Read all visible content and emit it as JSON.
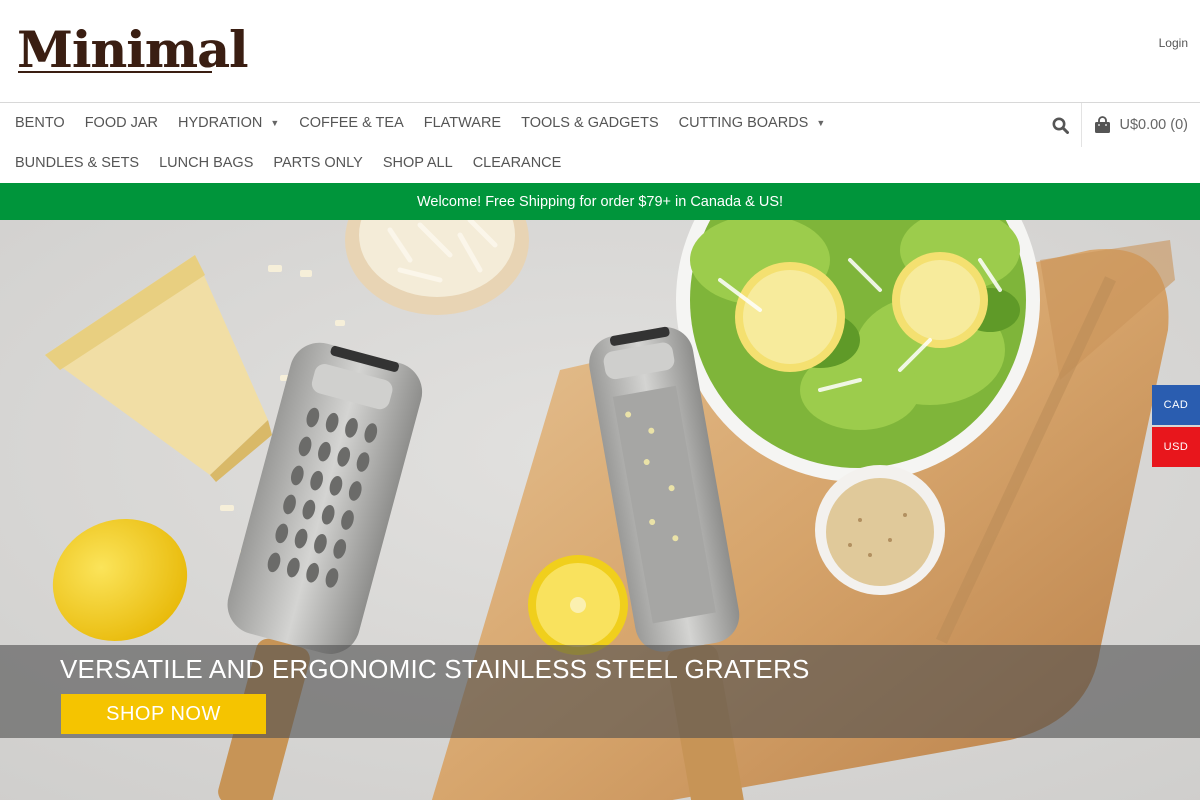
{
  "header": {
    "logo": "Minimal",
    "login": "Login"
  },
  "nav": {
    "row1": [
      {
        "label": "BENTO",
        "dropdown": false
      },
      {
        "label": "FOOD JAR",
        "dropdown": false
      },
      {
        "label": "HYDRATION",
        "dropdown": true
      },
      {
        "label": "COFFEE & TEA",
        "dropdown": false
      },
      {
        "label": "FLATWARE",
        "dropdown": false
      },
      {
        "label": "TOOLS & GADGETS",
        "dropdown": false
      },
      {
        "label": "CUTTING BOARDS",
        "dropdown": true
      }
    ],
    "row2": [
      {
        "label": "BUNDLES & SETS"
      },
      {
        "label": "LUNCH BAGS"
      },
      {
        "label": "PARTS ONLY"
      },
      {
        "label": "SHOP ALL"
      },
      {
        "label": "CLEARANCE"
      }
    ],
    "search_icon": "search-icon",
    "cart_icon": "shopping-bag-icon",
    "cart_label": "U$0.00 (0)"
  },
  "promo": {
    "text": "Welcome! Free Shipping for order $79+ in Canada & US!",
    "color": "#00953b"
  },
  "hero": {
    "title": "VERSATILE AND ERGONOMIC STAINLESS STEEL GRATERS",
    "button": "SHOP NOW",
    "button_color": "#f5c400"
  },
  "currency": {
    "cad": "CAD",
    "usd": "USD",
    "cad_color": "#2a5db0",
    "usd_color": "#e8161c"
  }
}
